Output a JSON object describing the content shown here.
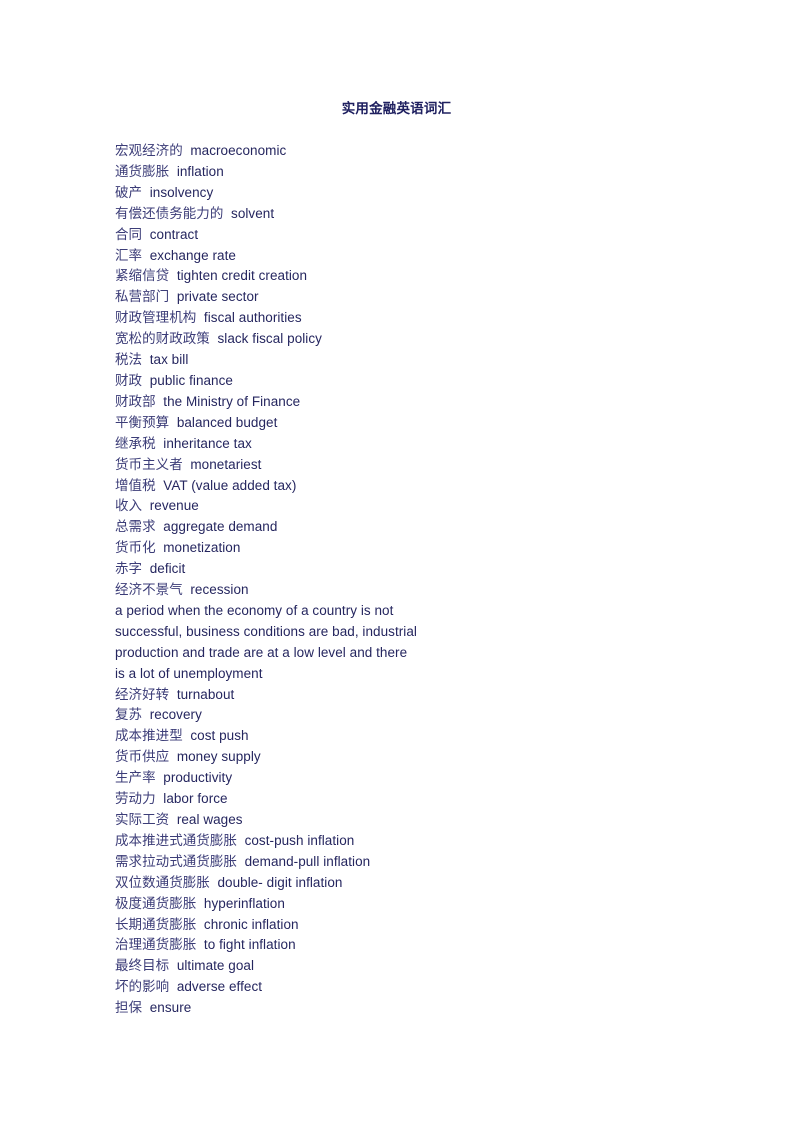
{
  "document": {
    "title": "实用金融英语词汇",
    "text_color": "#2e2f6d",
    "title_color": "#1f2060",
    "background_color": "#ffffff"
  },
  "entries": [
    {
      "cn": "宏观经济的",
      "en": "macroeconomic"
    },
    {
      "cn": "通货膨胀",
      "en": "inflation"
    },
    {
      "cn": "破产",
      "en": "insolvency"
    },
    {
      "cn": "有偿还债务能力的",
      "en": "solvent"
    },
    {
      "cn": "合同",
      "en": "contract"
    },
    {
      "cn": "汇率",
      "en": "exchange rate"
    },
    {
      "cn": "紧缩信贷",
      "en": "tighten credit creation"
    },
    {
      "cn": "私营部门",
      "en": "private sector"
    },
    {
      "cn": "财政管理机构",
      "en": "fiscal authorities"
    },
    {
      "cn": "宽松的财政政策",
      "en": "slack fiscal policy"
    },
    {
      "cn": "税法",
      "en": "tax bill"
    },
    {
      "cn": "财政",
      "en": "public finance"
    },
    {
      "cn": "财政部",
      "en": "the Ministry of Finance"
    },
    {
      "cn": "平衡预算",
      "en": "balanced budget"
    },
    {
      "cn": "继承税",
      "en": "inheritance tax"
    },
    {
      "cn": "货币主义者",
      "en": "monetariest"
    },
    {
      "cn": "增值税",
      "en": "VAT (value added tax)"
    },
    {
      "cn": "收入",
      "en": "revenue"
    },
    {
      "cn": "总需求",
      "en": "aggregate demand"
    },
    {
      "cn": "货币化",
      "en": "monetization"
    },
    {
      "cn": "赤字",
      "en": "deficit"
    },
    {
      "cn": "经济不景气",
      "en": "recession"
    },
    {
      "cn": "",
      "en": "a period when the economy of a country is not",
      "continuation": true
    },
    {
      "cn": "",
      "en": "successful, business conditions are bad, industrial",
      "continuation": true
    },
    {
      "cn": "",
      "en": "production and trade are at a low level and there",
      "continuation": true
    },
    {
      "cn": "",
      "en": "is a lot of unemployment",
      "continuation": true
    },
    {
      "cn": "经济好转",
      "en": "turnabout"
    },
    {
      "cn": "复苏",
      "en": "recovery"
    },
    {
      "cn": "成本推进型",
      "en": "cost push"
    },
    {
      "cn": "货币供应",
      "en": "money supply"
    },
    {
      "cn": "生产率",
      "en": "productivity"
    },
    {
      "cn": "劳动力",
      "en": "labor force"
    },
    {
      "cn": "实际工资",
      "en": "real wages"
    },
    {
      "cn": "成本推进式通货膨胀",
      "en": "cost-push inflation"
    },
    {
      "cn": "需求拉动式通货膨胀",
      "en": "demand-pull inflation"
    },
    {
      "cn": "双位数通货膨胀",
      "en": "double- digit inflation"
    },
    {
      "cn": "极度通货膨胀",
      "en": "hyperinflation"
    },
    {
      "cn": "长期通货膨胀",
      "en": "chronic inflation"
    },
    {
      "cn": "治理通货膨胀",
      "en": "to fight inflation"
    },
    {
      "cn": "最终目标",
      "en": "ultimate goal"
    },
    {
      "cn": "坏的影响",
      "en": "adverse effect"
    },
    {
      "cn": "担保",
      "en": "ensure"
    }
  ]
}
